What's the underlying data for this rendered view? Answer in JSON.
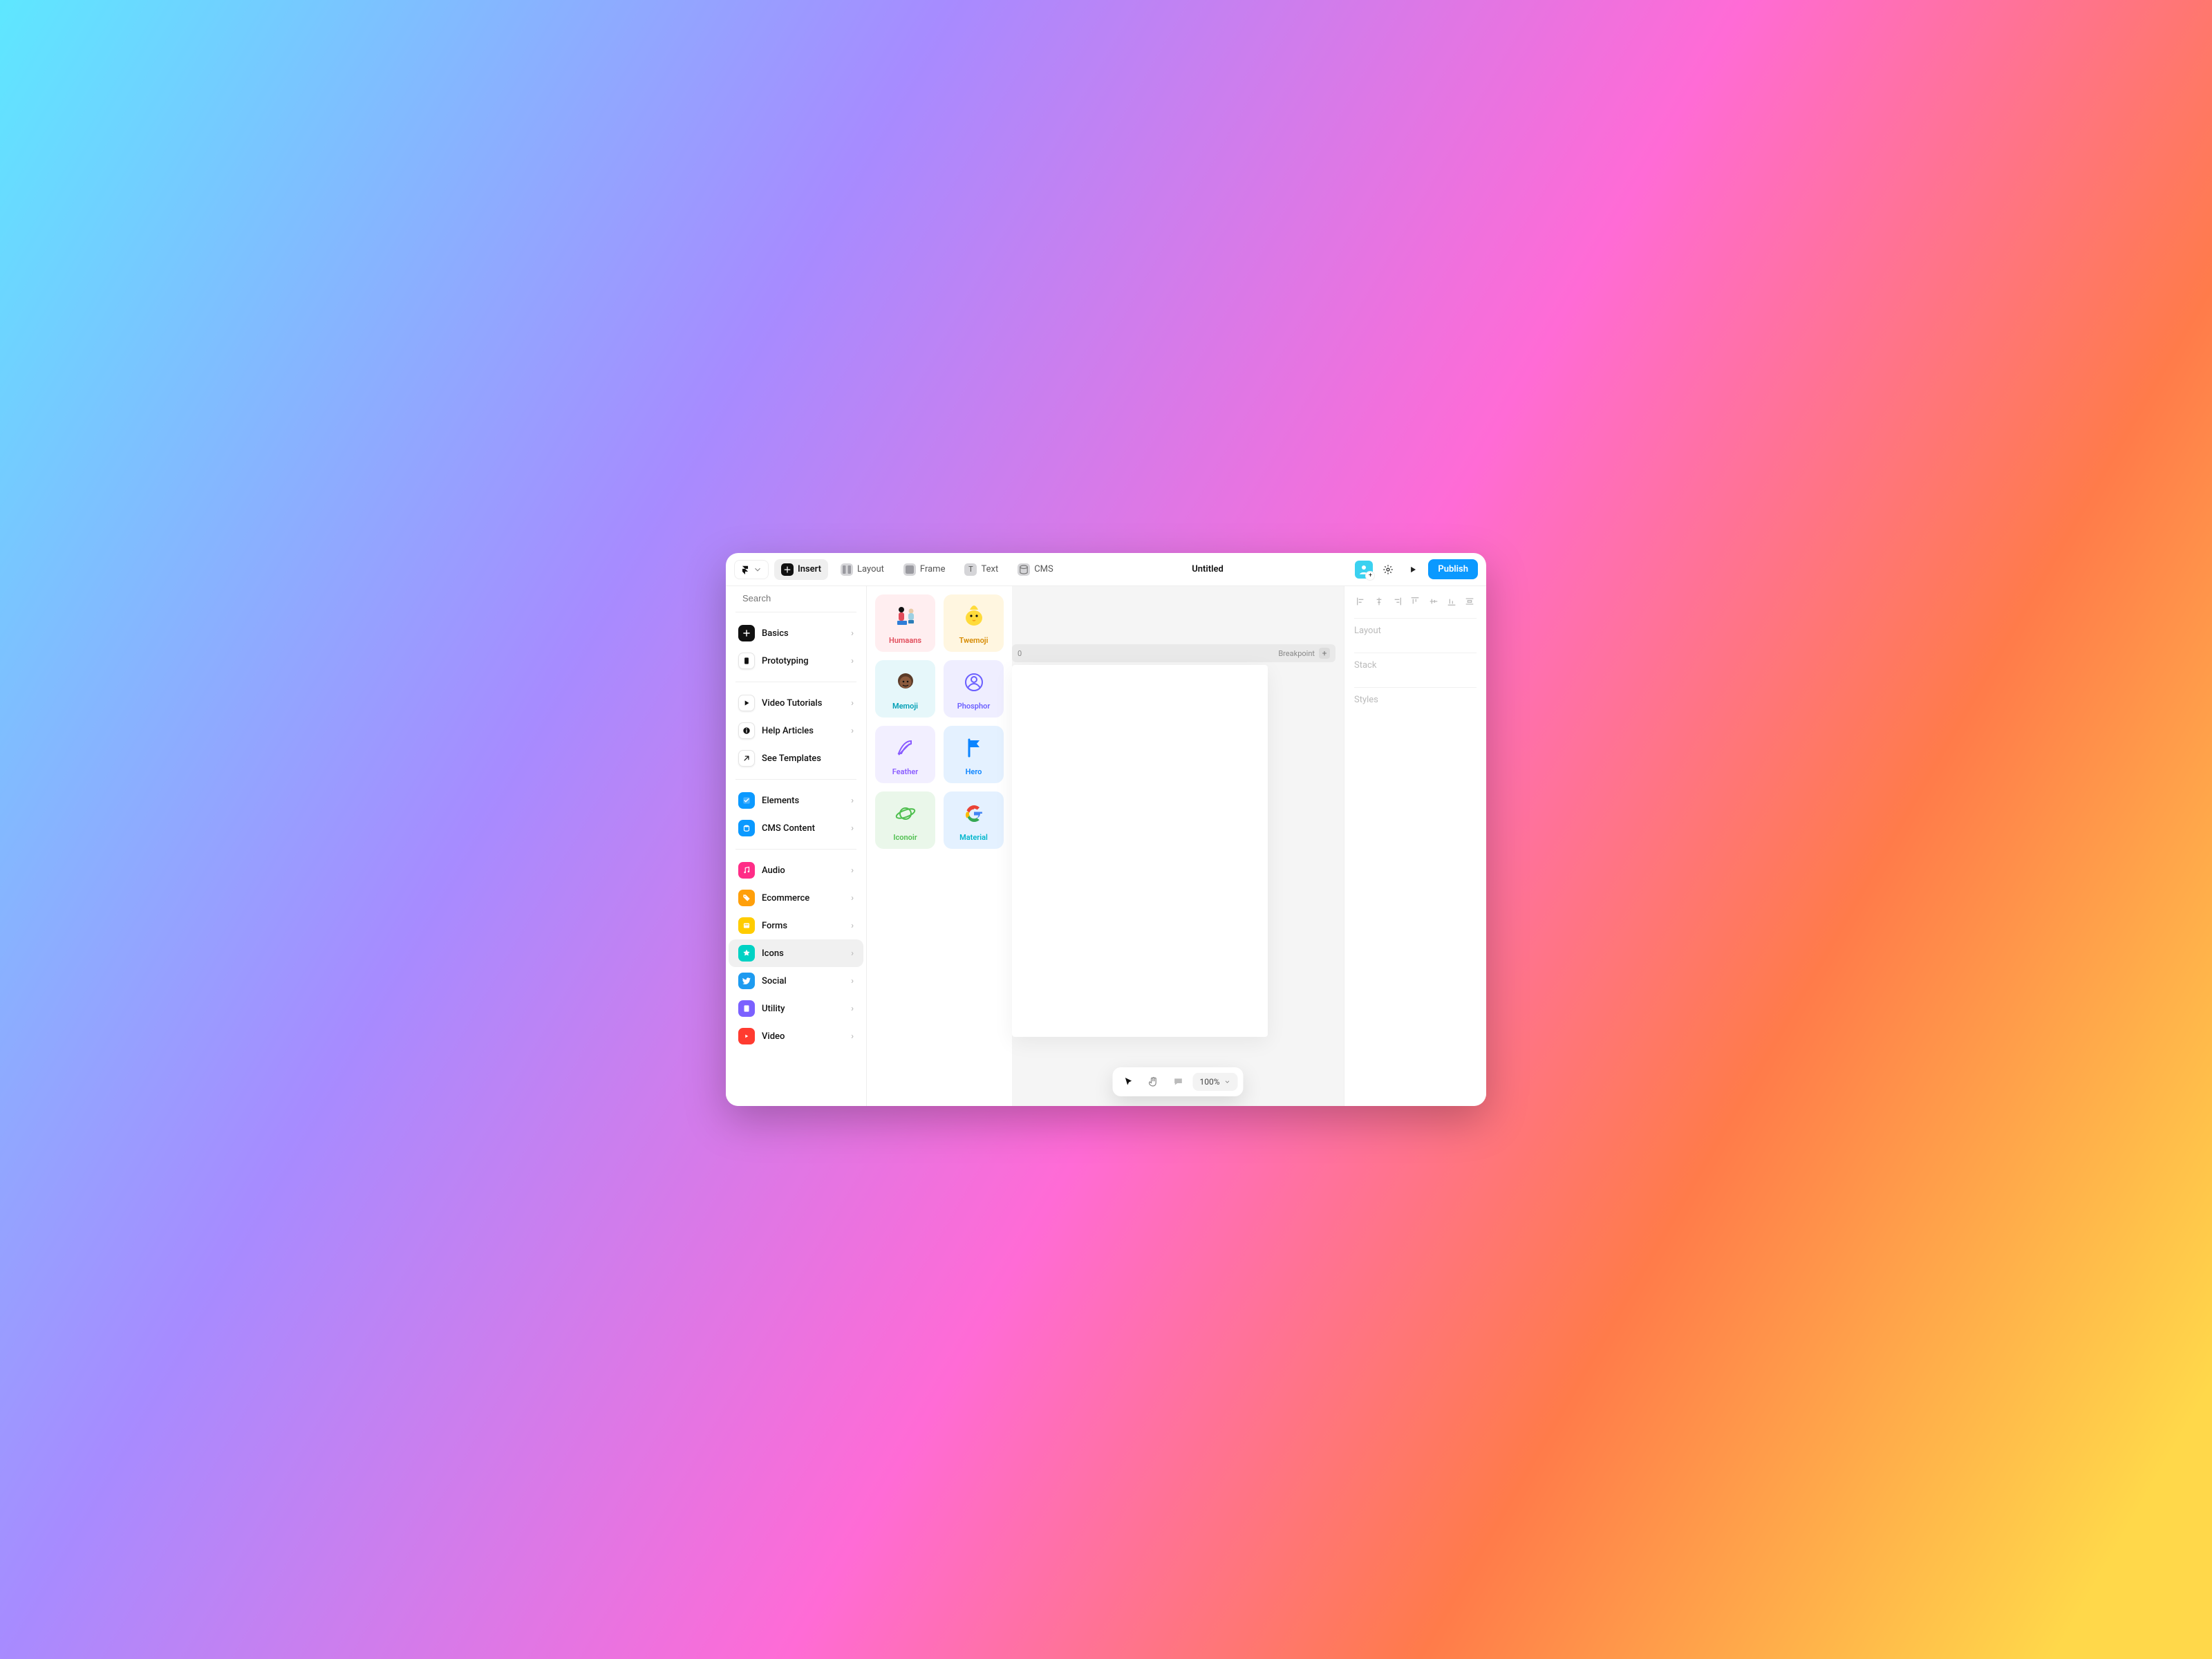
{
  "topbar": {
    "insert": "Insert",
    "layout": "Layout",
    "frame": "Frame",
    "text": "Text",
    "cms": "CMS",
    "title": "Untitled",
    "publish": "Publish"
  },
  "search": {
    "placeholder": "Search"
  },
  "sidebar": {
    "primary": [
      {
        "label": "Basics"
      },
      {
        "label": "Prototyping"
      }
    ],
    "help": [
      {
        "label": "Video Tutorials"
      },
      {
        "label": "Help Articles"
      },
      {
        "label": "See Templates"
      }
    ],
    "content": [
      {
        "label": "Elements"
      },
      {
        "label": "CMS Content"
      }
    ],
    "components": [
      {
        "label": "Audio"
      },
      {
        "label": "Ecommerce"
      },
      {
        "label": "Forms"
      },
      {
        "label": "Icons"
      },
      {
        "label": "Social"
      },
      {
        "label": "Utility"
      },
      {
        "label": "Video"
      }
    ],
    "selected": "Icons"
  },
  "icon_packs": [
    {
      "label": "Humaans"
    },
    {
      "label": "Twemoji"
    },
    {
      "label": "Memoji"
    },
    {
      "label": "Phosphor"
    },
    {
      "label": "Feather"
    },
    {
      "label": "Hero"
    },
    {
      "label": "Iconoir"
    },
    {
      "label": "Material"
    }
  ],
  "canvas": {
    "artboard_width_label": "0",
    "breakpoint_label": "Breakpoint"
  },
  "rightpanel": {
    "items": [
      {
        "label": "Layout"
      },
      {
        "label": "Stack"
      },
      {
        "label": "Styles"
      }
    ]
  },
  "bottombar": {
    "zoom": "100%"
  }
}
